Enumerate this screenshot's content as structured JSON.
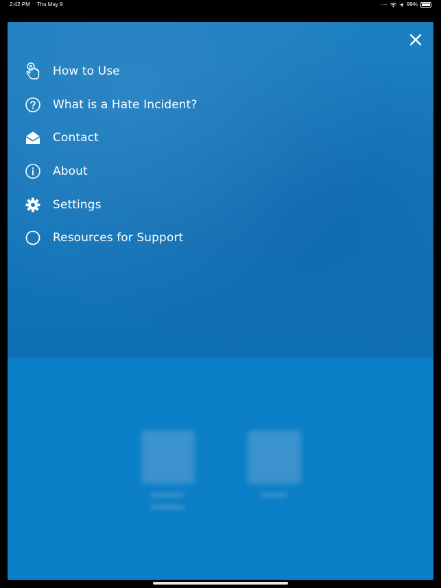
{
  "status_bar": {
    "time": "2:42 PM",
    "date": "Thu May 9",
    "battery": "99%"
  },
  "menu": {
    "items": [
      {
        "label": "How to Use",
        "icon": "pointer-hand-icon"
      },
      {
        "label": "What is a Hate Incident?",
        "icon": "question-circle-icon"
      },
      {
        "label": "Contact",
        "icon": "envelope-open-icon"
      },
      {
        "label": "About",
        "icon": "info-circle-icon"
      },
      {
        "label": "Settings",
        "icon": "gear-icon"
      },
      {
        "label": "Resources for Support",
        "icon": "circle-icon"
      }
    ]
  },
  "colors": {
    "overlay_blue": "#1678bb",
    "background_blue": "#0a7fc7",
    "text": "#ffffff"
  }
}
